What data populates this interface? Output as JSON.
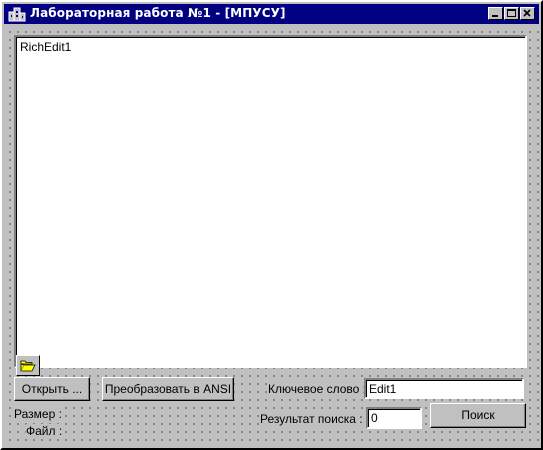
{
  "window": {
    "title": "Лабораторная работа №1  -  [МПУСУ]",
    "minimize_icon": "minimize-icon",
    "maximize_icon": "maximize-icon",
    "close_icon": "close-icon",
    "app_icon": "building-icon",
    "title_bar_color": "#000080"
  },
  "richedit": {
    "text": "RichEdit1"
  },
  "toolbar": {
    "folder_icon": "open-folder-icon",
    "open_label": "Открыть ...",
    "convert_label": "Преобразовать в ANSI"
  },
  "info": {
    "size_label": "Размер :",
    "file_label": "Файл :"
  },
  "search": {
    "keyword_label": "Ключевое слово :",
    "keyword_value": "Edit1",
    "result_label": "Результат поиска :",
    "result_value": "0",
    "search_label": "Поиск"
  }
}
